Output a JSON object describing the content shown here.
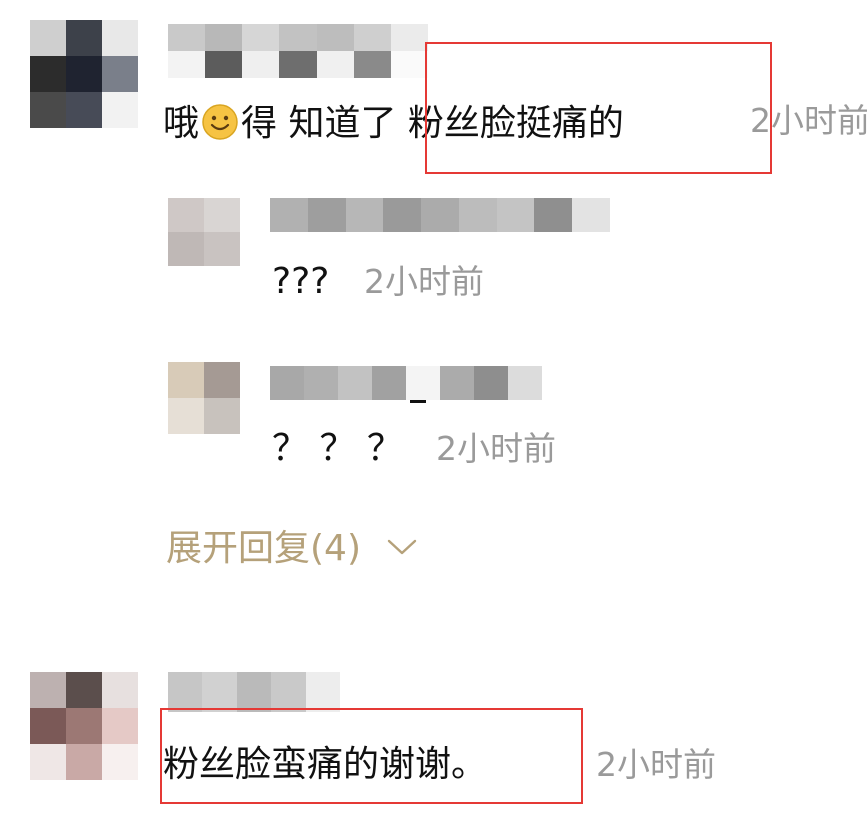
{
  "comments": [
    {
      "id": "comment-1",
      "text_before_emoji": "哦",
      "emoji": "smile-emoji",
      "text_after_emoji": "得 知道了 粉丝脸挺痛的",
      "time": "2小时前",
      "replies": [
        {
          "text": "???",
          "time": "2小时前"
        },
        {
          "text": "？ ？ ？",
          "time": "2小时前"
        }
      ],
      "expand_label": "展开回复(4)"
    },
    {
      "id": "comment-2",
      "text": "粉丝脸蛮痛的谢谢。",
      "time": "2小时前"
    }
  ],
  "colors": {
    "highlight_border": "#e53935",
    "expand_text": "#b5a17a",
    "timestamp": "#9a9a9a",
    "body_text": "#111111"
  },
  "icons": {
    "expand": "chevron-down-icon"
  }
}
